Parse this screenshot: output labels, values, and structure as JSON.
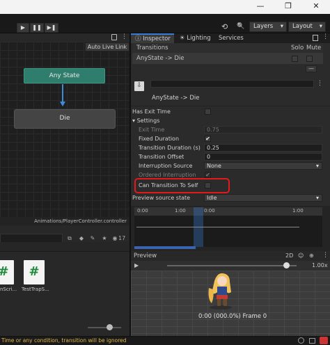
{
  "window": {
    "minimize_glyph": "—",
    "restore_glyph": "❐",
    "close_glyph": "✕"
  },
  "toolbar": {
    "play_glyph": "▶",
    "pause_glyph": "❚❚",
    "step_glyph": "▶❚",
    "history_glyph": "⟲",
    "search_glyph": "🔍",
    "layers_label": "Layers",
    "layout_label": "Layout",
    "dropdown_arrow": "▾"
  },
  "animator": {
    "auto_live_link": "Auto Live Link",
    "state_any": "Any State",
    "state_die": "Die",
    "path": "Animations/PlayerController.controller"
  },
  "project": {
    "count": "17",
    "scripts": [
      {
        "label": "nScri..."
      },
      {
        "label": "TestTrapS..."
      }
    ]
  },
  "status": {
    "message": "Time or any condition, transition will be ignored"
  },
  "inspector": {
    "tab_inspector": "Inspector",
    "tab_lighting": "Lighting",
    "tab_services": "Services",
    "transitions_header": "Transitions",
    "solo_label": "Solo",
    "mute_label": "Mute",
    "transition_item": "AnyState -> Die",
    "minus_glyph": "—",
    "sub_title": "AnyState -> Die",
    "has_exit_time_label": "Has Exit Time",
    "settings_label": "Settings",
    "exit_time_label": "Exit Time",
    "exit_time_value": "0.75",
    "fixed_duration_label": "Fixed Duration",
    "transition_duration_label": "Transition Duration (s)",
    "transition_duration_value": "0.25",
    "transition_offset_label": "Transition Offset",
    "transition_offset_value": "0",
    "interruption_source_label": "Interruption Source",
    "interruption_source_value": "None",
    "ordered_interruption_label": "Ordered Interruption",
    "can_transition_label": "Can Transition To Self",
    "preview_source_label": "Preview source state",
    "preview_source_value": "Idle",
    "check_glyph": "✔"
  },
  "timeline": {
    "ticks": [
      "0:00",
      "1:00",
      "0:00",
      "1:00"
    ]
  },
  "preview": {
    "title": "Preview",
    "mode_2d": "2D",
    "speed": "1.00x",
    "frame_text": "0:00 (000.0%) Frame 0"
  }
}
